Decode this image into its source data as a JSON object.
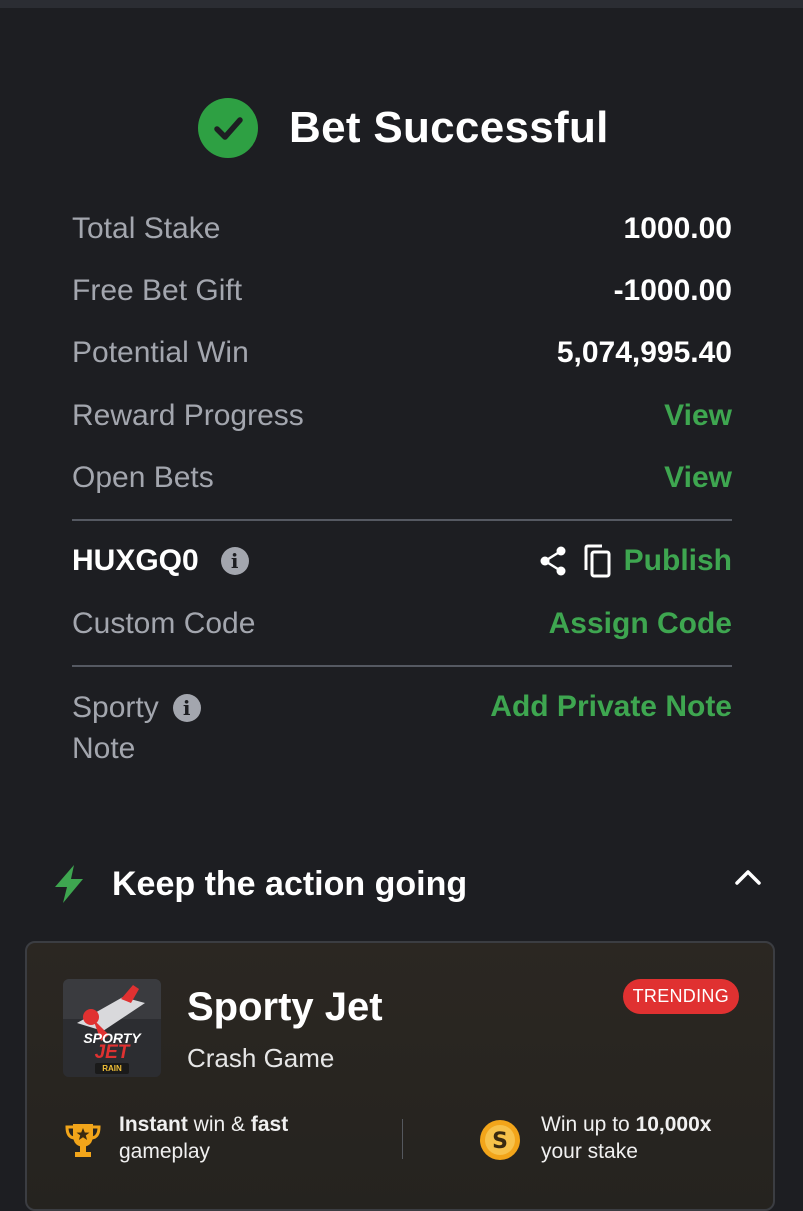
{
  "header": {
    "title": "Bet Successful"
  },
  "summary": {
    "total_stake_label": "Total Stake",
    "total_stake_value": "1000.00",
    "free_bet_label": "Free Bet Gift",
    "free_bet_value": "-1000.00",
    "potential_win_label": "Potential Win",
    "potential_win_value": "5,074,995.40",
    "reward_progress_label": "Reward Progress",
    "reward_progress_action": "View",
    "open_bets_label": "Open Bets",
    "open_bets_action": "View"
  },
  "booking": {
    "code": "HUXGQ0",
    "publish_label": "Publish",
    "custom_code_label": "Custom Code",
    "assign_code_label": "Assign Code"
  },
  "note": {
    "label_line1": "Sporty",
    "label_line2": "Note",
    "add_note_label": "Add Private Note"
  },
  "promo": {
    "section_title": "Keep the action going",
    "game_name": "Sporty Jet",
    "game_type": "Crash Game",
    "badge": "TRENDING",
    "feature1_bold1": "Instant",
    "feature1_text1": " win & ",
    "feature1_bold2": "fast",
    "feature1_text2": "gameplay",
    "feature2_text1": "Win up to ",
    "feature2_bold": "10,000x",
    "feature2_text2": "your stake",
    "logo_text1": "SPORTY",
    "logo_text2": "JET",
    "logo_text3": "RAIN"
  },
  "colors": {
    "background": "#1d1e22",
    "accent_green": "#3ea650",
    "check_green": "#2ea043",
    "trending_red": "#e03131",
    "muted_text": "#a3a6ae"
  },
  "icons": [
    "check-icon",
    "info-icon",
    "share-icon",
    "copy-icon",
    "bolt-icon",
    "chevron-up-icon",
    "trophy-icon",
    "coin-icon"
  ]
}
